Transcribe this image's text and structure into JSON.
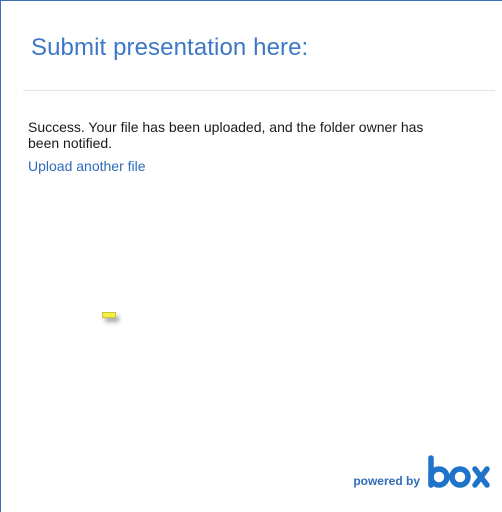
{
  "header": {
    "title": "Submit presentation here:"
  },
  "message": {
    "text": "Success. Your file has been uploaded, and the folder owner has been notified.",
    "link_label": "Upload another file"
  },
  "footer": {
    "powered_by": "powered by",
    "logo_text": "box"
  },
  "colors": {
    "accent": "#3d78c6",
    "link": "#2f6bbb",
    "border": "#3b6fb6"
  }
}
